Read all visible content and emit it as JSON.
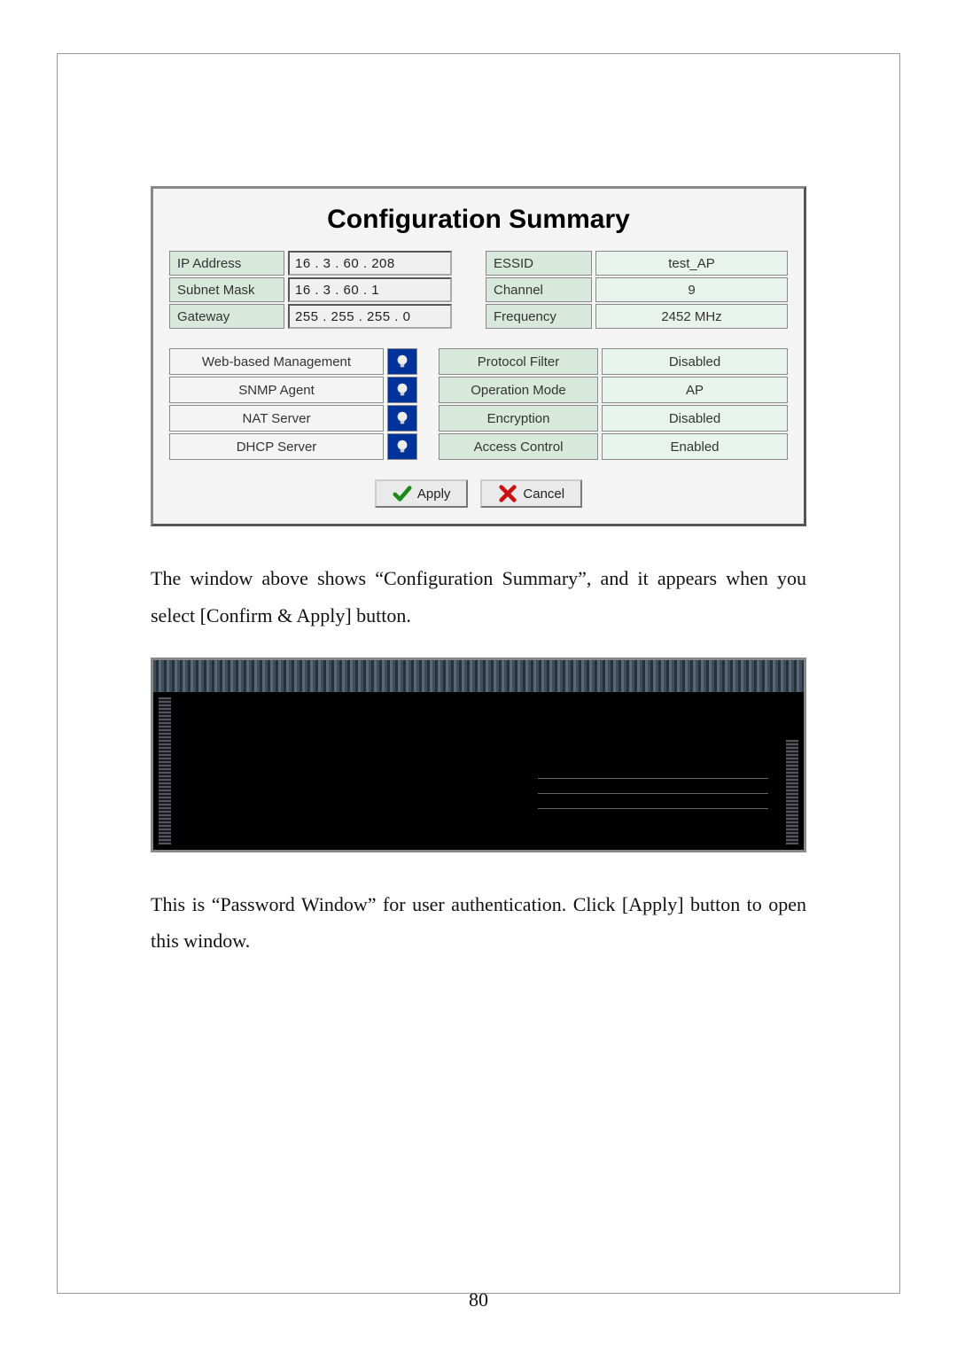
{
  "config_window": {
    "title": "Configuration Summary",
    "network": {
      "ip_label": "IP Address",
      "ip_value": "16  .   3   .  60  . 208",
      "subnet_label": "Subnet Mask",
      "subnet_value": "16  .   3   .  60  .   1",
      "gateway_label": "Gateway",
      "gateway_value": "255 . 255 . 255 .   0"
    },
    "wireless": {
      "essid_label": "ESSID",
      "essid_value": "test_AP",
      "channel_label": "Channel",
      "channel_value": "9",
      "freq_label": "Frequency",
      "freq_value": "2452 MHz"
    },
    "features": [
      {
        "label": "Web-based Management",
        "prop": "Protocol Filter",
        "value": "Disabled"
      },
      {
        "label": "SNMP Agent",
        "prop": "Operation Mode",
        "value": "AP"
      },
      {
        "label": "NAT Server",
        "prop": "Encryption",
        "value": "Disabled"
      },
      {
        "label": "DHCP Server",
        "prop": "Access Control",
        "value": "Enabled"
      }
    ],
    "apply_label": "Apply",
    "cancel_label": "Cancel"
  },
  "paragraph1": "The window above shows “Configuration Summary”, and it appears when you select [Confirm & Apply] button.",
  "paragraph2": "This is “Password Window” for user authentication. Click [Apply] button to open this window.",
  "page_number": "80"
}
